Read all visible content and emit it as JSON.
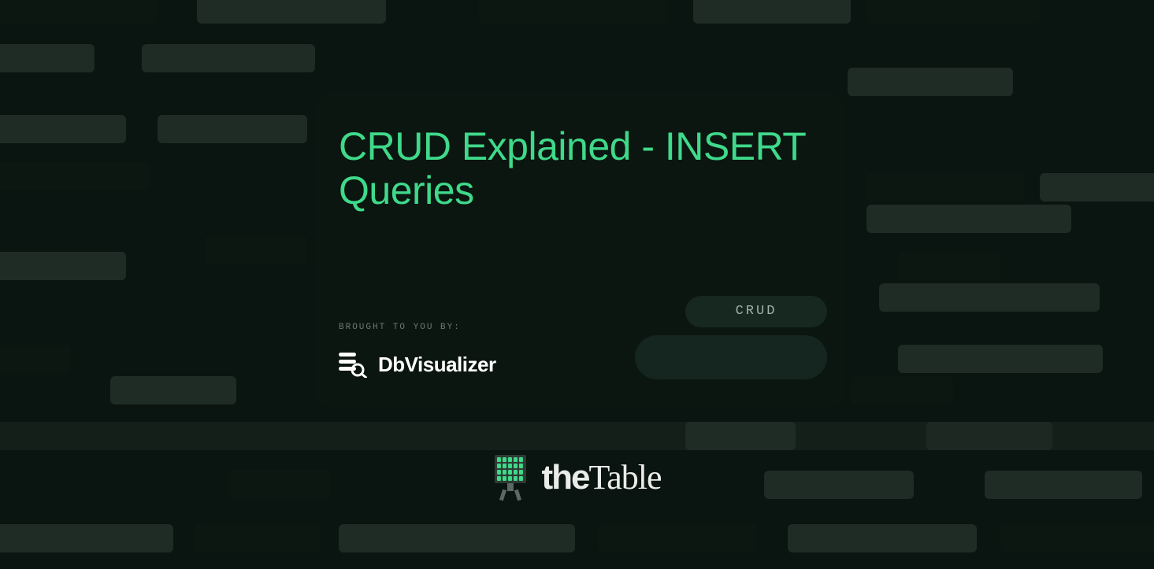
{
  "card": {
    "title": "CRUD Explained - INSERT Queries",
    "brought_label": "BROUGHT TO YOU BY:",
    "sponsor_name": "DbVisualizer",
    "tags": [
      "CRUD"
    ]
  },
  "footer": {
    "brand_prefix": "the",
    "brand_suffix": "Table"
  },
  "colors": {
    "accent": "#3fd98a",
    "card_bg": "#0b1610",
    "page_bg": "#0a1410"
  }
}
